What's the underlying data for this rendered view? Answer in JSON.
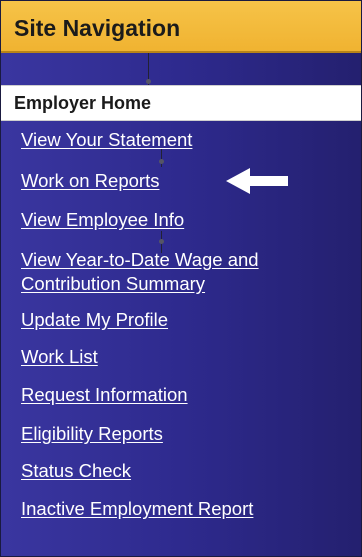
{
  "header": {
    "title": "Site Navigation"
  },
  "current": {
    "label": "Employer Home"
  },
  "links": [
    {
      "label": "View Your Statement"
    },
    {
      "label": "Work on Reports"
    },
    {
      "label": "View Employee Info"
    },
    {
      "label": "View Year-to-Date Wage and Contribution Summary"
    },
    {
      "label": "Update My Profile"
    },
    {
      "label": "Work List"
    },
    {
      "label": "Request Information"
    },
    {
      "label": "Eligibility Reports"
    },
    {
      "label": "Status Check"
    },
    {
      "label": "Inactive Employment Report"
    }
  ],
  "annotations": {
    "arrow": "arrow-left-icon",
    "arrow_color": "#ffffff"
  },
  "colors": {
    "header_bg": "#f3b93a",
    "panel_bg": "#2e2a8e",
    "link": "#ffffff"
  }
}
